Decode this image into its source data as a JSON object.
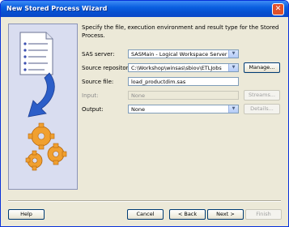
{
  "window": {
    "title": "New Stored Process Wizard",
    "close_glyph": "✕"
  },
  "description": "Specify the file, execution environment and result type for the Stored Process.",
  "form": {
    "sas_server": {
      "label": "SAS server:",
      "value": "SASMain - Logical Workspace Server"
    },
    "source_repository": {
      "label": "Source repository:",
      "value": "C:\\Workshop\\winsas\\sbiov\\ETLJobs",
      "button": "Manage..."
    },
    "source_file": {
      "label": "Source file:",
      "value": "load_productdim.sas"
    },
    "input": {
      "label": "Input:",
      "value": "None",
      "button": "Streams..."
    },
    "output": {
      "label": "Output:",
      "value": "None",
      "button": "Details..."
    }
  },
  "footer": {
    "help": "Help",
    "cancel": "Cancel",
    "back": "< Back",
    "next": "Next >",
    "finish": "Finish"
  },
  "colors": {
    "titlebar": "#0a5fe0",
    "dialog_bg": "#ece9d8",
    "disabled_text": "#8b8b8b"
  },
  "icons": {
    "side_illustration": "document-arrow-gears-icon",
    "dropdown": "chevron-down-icon"
  }
}
